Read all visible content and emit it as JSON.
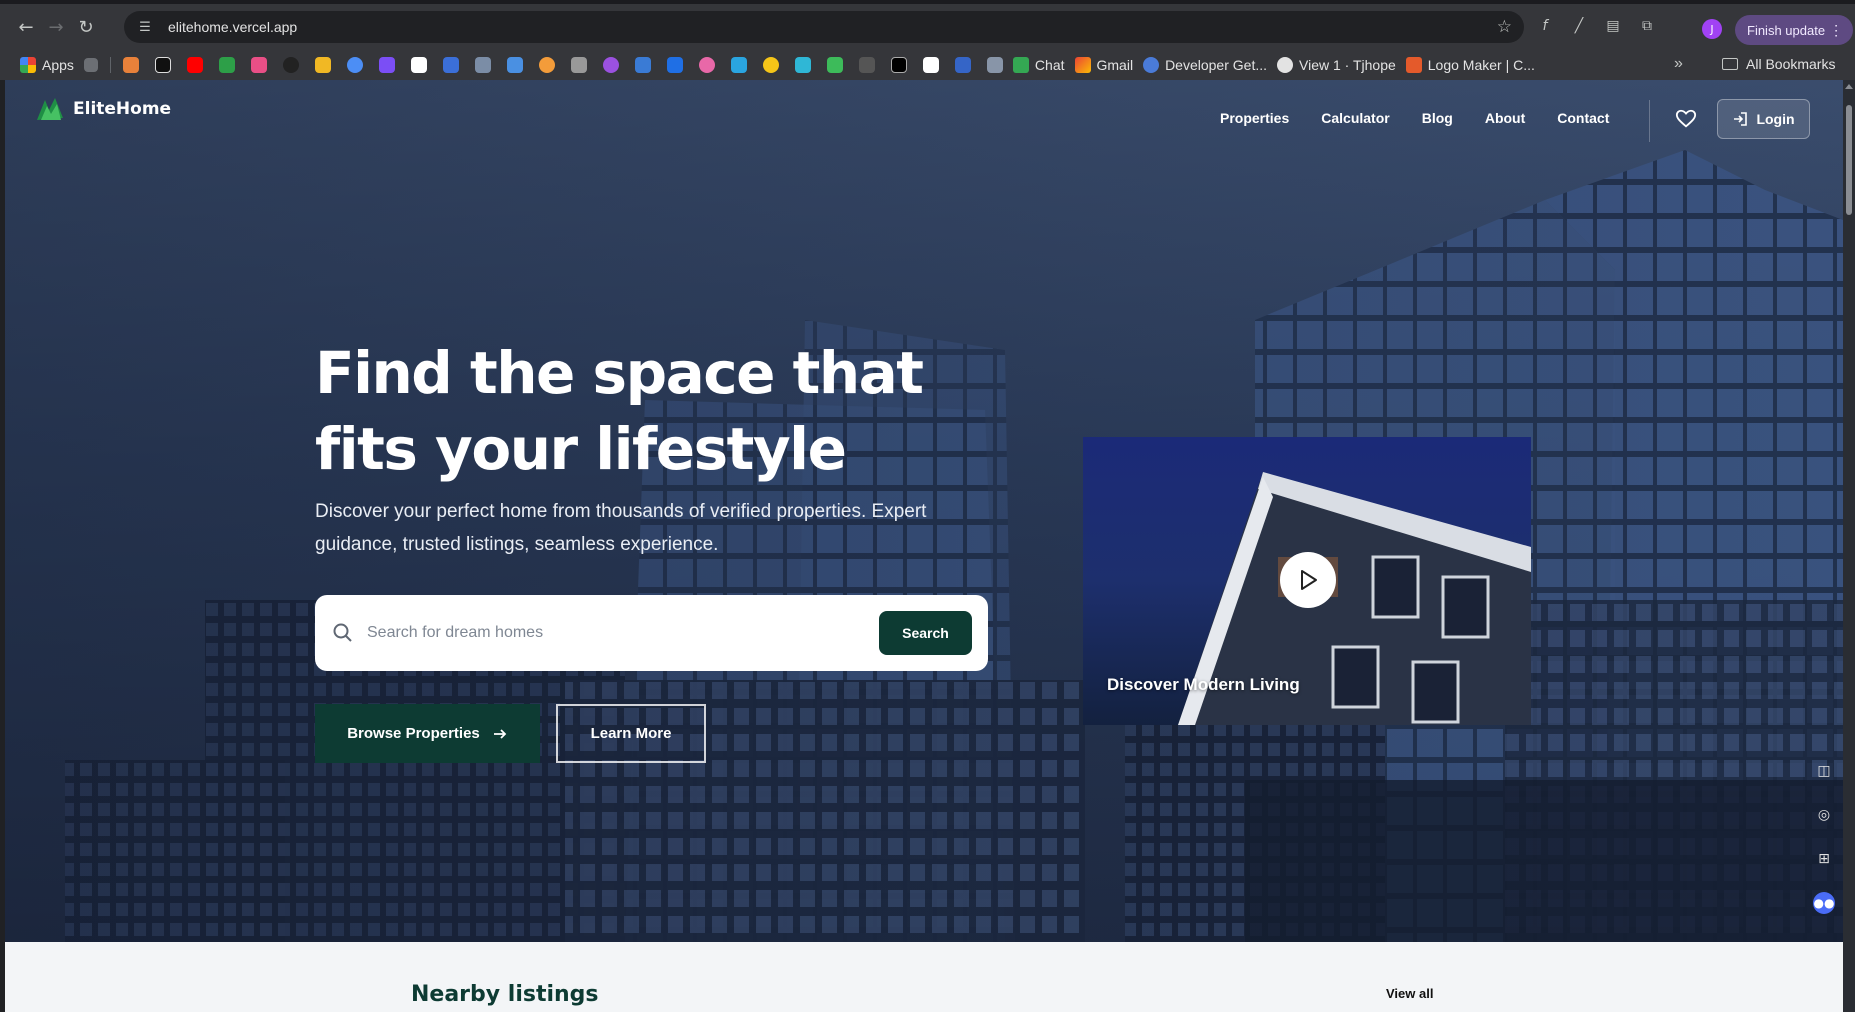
{
  "browser": {
    "url": "elitehome.vercel.app",
    "update_label": "Finish update",
    "profile_initial": "J",
    "bookmarks": {
      "apps": "Apps",
      "chat": "Chat",
      "gmail": "Gmail",
      "developer": "Developer Get...",
      "github": "View 1 · Tjhope",
      "logomaker": "Logo Maker | C...",
      "all": "All Bookmarks"
    }
  },
  "site": {
    "brand": "EliteHome",
    "nav": [
      "Properties",
      "Calculator",
      "Blog",
      "About",
      "Contact"
    ],
    "login_label": "Login",
    "hero": {
      "headline": "Find the space that fits your lifestyle",
      "subline": "Discover your perfect home from thousands of verified properties. Expert guidance, trusted listings, seamless experience.",
      "search_placeholder": "Search for dream homes",
      "search_button": "Search",
      "browse_button": "Browse Properties",
      "learn_button": "Learn More",
      "video_caption": "Discover Modern Living"
    },
    "nearby": {
      "title": "Nearby listings",
      "view_all": "View all"
    }
  },
  "colors": {
    "brand_dark_green": "#0d3b33",
    "hero_overlay": "#2c3d5c",
    "chrome_update": "#5e4a82"
  }
}
